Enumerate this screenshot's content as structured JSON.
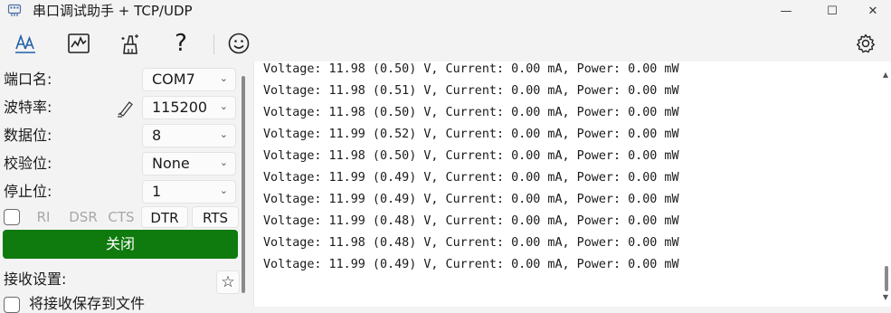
{
  "window": {
    "title": "串口调试助手 + TCP/UDP",
    "minimize_glyph": "—",
    "maximize_glyph": "☐",
    "close_glyph": "✕"
  },
  "toolbar": {
    "items": [
      {
        "name": "font-icon"
      },
      {
        "name": "chart-icon"
      },
      {
        "name": "clean-icon"
      },
      {
        "name": "help-icon",
        "glyph": "?"
      },
      {
        "name": "smiley-icon",
        "glyph": "☺"
      },
      {
        "name": "settings-icon"
      }
    ]
  },
  "serial": {
    "port_label": "端口名:",
    "port_value": "COM7",
    "baud_label": "波特率:",
    "baud_value": "115200",
    "databits_label": "数据位:",
    "databits_value": "8",
    "parity_label": "校验位:",
    "parity_value": "None",
    "stopbits_label": "停止位:",
    "stopbits_value": "1",
    "chevron": "⌄",
    "signals": {
      "ri": "RI",
      "dsr": "DSR",
      "cts": "CTS",
      "dtr": "DTR",
      "rts": "RTS"
    },
    "toggle_button": "关闭",
    "toggle_color": "#0f7b0f"
  },
  "receive": {
    "label": "接收设置:",
    "star_glyph": "☆",
    "save_to_file_label": "将接收保存到文件"
  },
  "output": {
    "lines": [
      "Voltage: 11.98 (0.50) V, Current: 0.00 mA, Power: 0.00 mW",
      "Voltage: 11.98 (0.51) V, Current: 0.00 mA, Power: 0.00 mW",
      "Voltage: 11.98 (0.50) V, Current: 0.00 mA, Power: 0.00 mW",
      "Voltage: 11.99 (0.52) V, Current: 0.00 mA, Power: 0.00 mW",
      "Voltage: 11.98 (0.50) V, Current: 0.00 mA, Power: 0.00 mW",
      "Voltage: 11.99 (0.49) V, Current: 0.00 mA, Power: 0.00 mW",
      "Voltage: 11.99 (0.49) V, Current: 0.00 mA, Power: 0.00 mW",
      "Voltage: 11.99 (0.48) V, Current: 0.00 mA, Power: 0.00 mW",
      "Voltage: 11.98 (0.48) V, Current: 0.00 mA, Power: 0.00 mW",
      "Voltage: 11.99 (0.49) V, Current: 0.00 mA, Power: 0.00 mW"
    ]
  }
}
